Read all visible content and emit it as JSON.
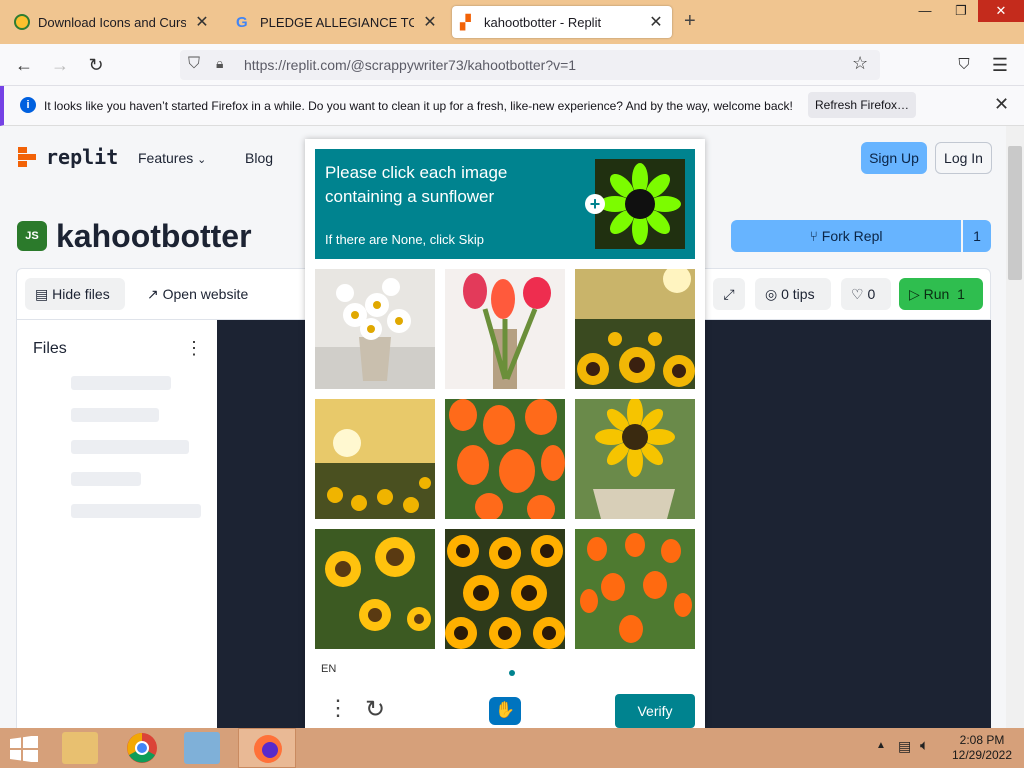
{
  "browser": {
    "tabs": [
      {
        "title": "Download Icons and Cursors",
        "active": false
      },
      {
        "title": "PLEDGE ALLEGIANCE TO ANTI-",
        "active": false
      },
      {
        "title": "kahootbotter - Replit",
        "active": true
      }
    ],
    "new_tab_label": "+",
    "url": "https://replit.com/@scrappywriter73/kahootbotter?v=1",
    "notification": {
      "text": "It looks like you haven’t started Firefox in a while. Do you want to clean it up for a fresh, like-new experience? And by the way, welcome back!",
      "button_label": "Refresh Firefox…"
    }
  },
  "replit": {
    "logo_text": "replit",
    "nav": {
      "features": "Features",
      "blog": "Blog"
    },
    "sign_up": "Sign Up",
    "log_in": "Log In",
    "repl_title": "kahootbotter",
    "repl_icon_text": "JS",
    "fork_label": "Fork Repl",
    "fork_count": "1",
    "toolbar": {
      "hide_files": "Hide files",
      "open_website": "Open website",
      "tips": "0 tips",
      "likes": "0",
      "run_label": "Run",
      "run_count": "1"
    },
    "files_title": "Files",
    "accent_color": "#67b4ff",
    "run_color": "#2fbe4f"
  },
  "captcha": {
    "prompt": "Please click each image containing a sunflower",
    "subtext": "If there are None, click Skip",
    "language": "EN",
    "verify_label": "Verify",
    "accent_color": "#00838f",
    "images": [
      {
        "subject": "daisies in pot"
      },
      {
        "subject": "tulips in vase"
      },
      {
        "subject": "sunflower field at sunset"
      },
      {
        "subject": "sunflower field at sunset"
      },
      {
        "subject": "orange tulips"
      },
      {
        "subject": "sunflower in pot"
      },
      {
        "subject": "sunflowers"
      },
      {
        "subject": "sunflowers"
      },
      {
        "subject": "orange tulips field"
      }
    ]
  },
  "taskbar": {
    "time": "2:08 PM",
    "date": "12/29/2022"
  }
}
